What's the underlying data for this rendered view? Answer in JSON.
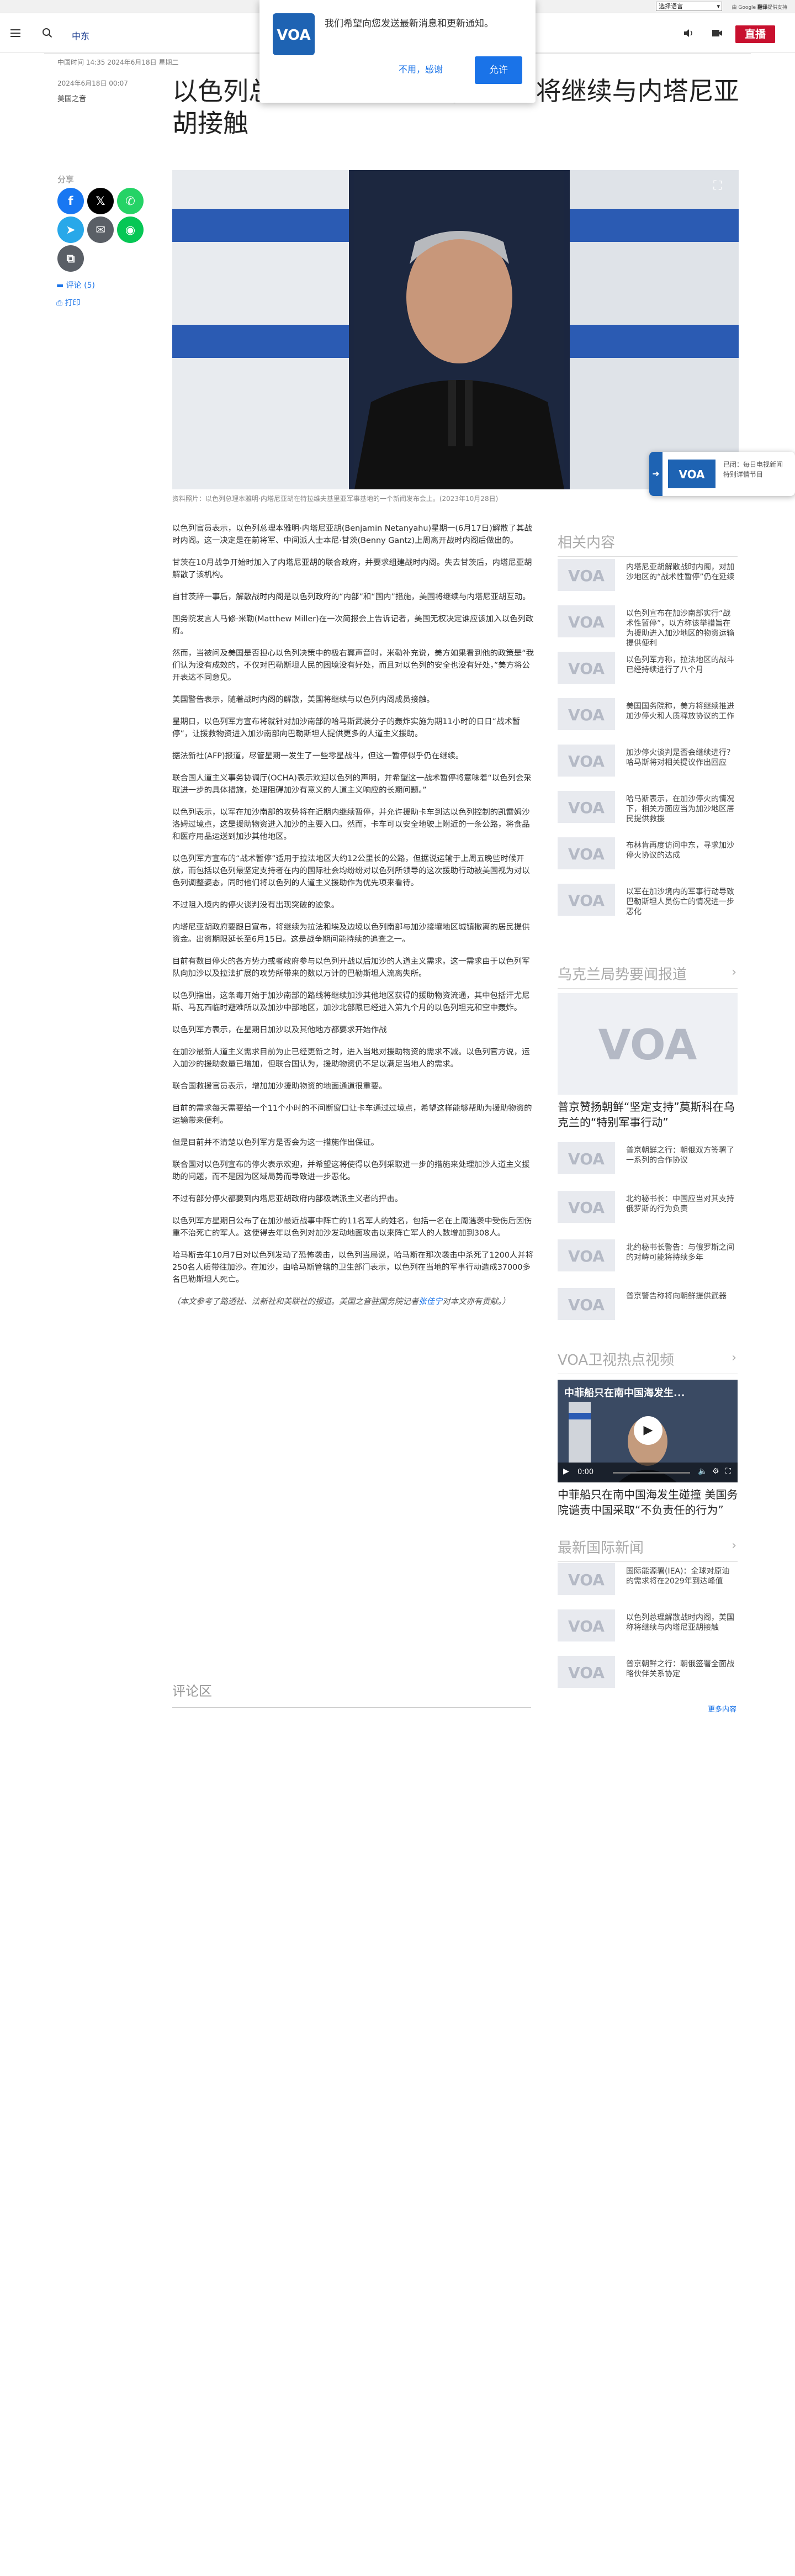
{
  "translate_bar": {
    "select_label": "选择语言",
    "powered_label": "由 Google",
    "powered_brand": "翻译",
    "powered_suffix": "提供支持"
  },
  "header": {
    "site_name": "中东",
    "live_label": "直播"
  },
  "notification": {
    "message": "我们希望向您发送最新消息和更新通知。",
    "decline_label": "不用，感谢",
    "accept_label": "允许"
  },
  "meta": {
    "updated": "中国时间 14:35 2024年6月18日 星期二",
    "date": "2024年6月18日 00:07",
    "source": "美国之音"
  },
  "title": "以色列总理解散战时内阁,美国称将继续与内塔尼亚胡接触",
  "share": {
    "label": "分享",
    "comments_label": "评论 (5)",
    "print_label": "打印"
  },
  "image_caption": "资料照片：以色列总理本雅明·内塔尼亚胡在特拉维夫基里亚军事基地的一个新闻发布会上。(2023年10月28日)",
  "floating_audio": {
    "line1": "已闭：每日电视新闻",
    "line2": "特别详情节目"
  },
  "paragraphs": [
    "以色列官员表示，以色列总理本雅明·内塔尼亚胡(Benjamin Netanyahu)星期一(6月17日)解散了其战时内阁。这一决定是在前将军、中间派人士本尼·甘茨(Benny Gantz)上周离开战时内阁后做出的。",
    "甘茨在10月战争开始时加入了内塔尼亚胡的联合政府，并要求组建战时内阁。失去甘茨后，内塔尼亚胡解散了该机构。",
    "自甘茨辞一事后，解散战时内阁是以色列政府的“内部”和“国内”措施，美国将继续与内塔尼亚胡互动。",
    "国务院发言人马修·米勒(Matthew Miller)在一次简报会上告诉记者，美国无权决定谁应该加入以色列政府。",
    "然而，当被问及美国是否担心以色列决策中的极右翼声音时，米勒补充说，美方如果看到他的政策是“我们认为没有成效的，不仅对巴勒斯坦人民的困境没有好处，而且对以色列的安全也没有好处，”美方将公开表达不同意见。",
    "美国警告表示，随着战时内阁的解散，美国将继续与以色列内阁成员接触。",
    "星期日，以色列军方宣布将就针对加沙南部的哈马斯武装分子的轰炸实施为期11小时的日日“战术暂停”，让援救物资进入加沙南部向巴勒斯坦人提供更多的人道主义援助。",
    "据法新社(AFP)报道，尽管星期一发生了一些零星战斗，但这一暂停似乎仍在继续。",
    "联合国人道主义事务协调厅(OCHA)表示欢迎以色列的声明，并希望这一战术暂停将意味着“以色列会采取进一步的具体措施，处理阻碍加沙有意义的人道主义响应的长期问题。”",
    "以色列表示，以军在加沙南部的攻势将在近期内继续暂停，并允许援助卡车到达以色列控制的凯雷姆沙洛姆过境点，这是援助物资进入加沙的主要入口。然而，卡车可以安全地驶上附近的一条公路，将食品和医疗用品运送到加沙其他地区。",
    "以色列军方宣布的“战术暂停”适用于拉法地区大约12公里长的公路，但据说运输于上周五晚些时候开放，而包括以色列最坚定支持者在内的国际社会均纷纷对以色列所领导的这次援助行动被美国视为对以色列调整姿态，同时他们将以色列的人道主义援助作为优先项来看待。",
    "不过阻入境内的停火谈判没有出现突破的迹象。",
    "内塔尼亚胡政府要跟日宣布，将继续为拉法和埃及边境以色列南部与加沙接壤地区城镇撤离的居民提供资金。出资期限延长至6月15日。这是战争期间能持续的追查之一。",
    "目前有数目停火的各方势力或者政府参与以色列开战以后加沙的人道主义需求。这一需求由于以色列军队向加沙以及拉法扩展的攻势所带来的数以万计的巴勒斯坦人流离失所。",
    "以色列指出，这条毒开始于加沙南部的路线将继续加沙其他地区获得的援助物资流通，其中包括汗尤尼斯、马瓦西临时避难所以及加沙中部地区，加沙北部限已经进入第九个月的以色列坦克和空中轰炸。",
    "以色列军方表示，在星期日加沙以及其他地方都要求开始作战",
    "在加沙最新人道主义需求目前为止已经更新之时，进入当地对援助物资的需求不减。以色列官方说，运入加沙的援助数量已增加，但联合国认为，援助物资仍不足以满足当地人的需求。",
    "联合国救援官员表示，增加加沙援助物资的地面通道很重要。",
    "目前的需求每天需要给一个11个小时的不间断窗口让卡车通过过境点，希望这样能够帮助为援助物资的运输带来便利。",
    "但是目前并不清楚以色列军方是否会为这一措施作出保证。",
    "联合国对以色列宣布的停火表示欢迎，并希望这将使得以色列采取进一步的措施来处理加沙人道主义援助的问题，而不是因为区域局势而导致进一步恶化。",
    "不过有部分停火都要到内塔尼亚胡政府内部极端派主义者的抨击。",
    "以色列军方星期日公布了在加沙最近战事中阵亡的11名军人的姓名，包括一名在上周遇袭中受伤后因伤重不治死亡的军人。这使得去年以色列对加沙发动地面攻击以来阵亡军人的人数增加到308人。",
    "哈马斯去年10月7日对以色列发动了恐怖袭击，以色列当局说，哈马斯在那次袭击中杀死了1200人并将250名人质带往加沙。在加沙，由哈马斯管辖的卫生部门表示，以色列在当地的军事行动造成37000多名巴勒斯坦人死亡。"
  ],
  "footnote": {
    "text": "（本文参考了路透社、法新社和美联社的报道。美国之音驻国务院记者张佳宁对本文亦有贡献。）",
    "author": "张佳宁"
  },
  "comments_title": "评论区",
  "related": {
    "title": "相关内容",
    "items": [
      "内塔尼亚胡解散战时内阁，对加沙地区的“战术性暂停”仍在延续",
      "以色列宣布在加沙南部实行“战术性暂停”，以方称该举措旨在为援助进入加沙地区的物资运输提供便利",
      "以色列军方称，拉法地区的战斗已经持续进行了八个月",
      "美国国务院称，美方将继续推进加沙停火和人质释放协议的工作",
      "加沙停火谈判是否会继续进行？哈马斯将对相关提议作出回应",
      "哈马斯表示，在加沙停火的情况下，相关方面应当为加沙地区居民提供救援",
      "布林肯再度访问中东，寻求加沙停火协议的达成",
      "以军在加沙境内的军事行动导致巴勒斯坦人员伤亡的情况进一步恶化"
    ]
  },
  "ukraine": {
    "title": "乌克兰局势要闻报道",
    "headline": "普京赞扬朝鲜“坚定支持”莫斯科在乌克兰的“特别军事行动”",
    "items": [
      "普京朝鲜之行：朝俄双方签署了一系列的合作协议",
      "北约秘书长：中国应当对其支持俄罗斯的行为负责",
      "北约秘书长警告：与俄罗斯之间的对峙可能将持续多年",
      "普京警告称将向朝鲜提供武器"
    ]
  },
  "video": {
    "title": "VOA卫视热点视频",
    "overlay": "中菲船只在南中国海发生...",
    "time": "0:00",
    "headline": "中菲船只在南中国海发生碰撞 美国务院谴责中国采取“不负责任的行为”"
  },
  "latest": {
    "title": "最新国际新闻",
    "items": [
      "国际能源署(IEA)：全球对原油的需求将在2029年到达峰值",
      "以色列总理解散战时内阁，美国称将继续与内塔尼亚胡接触",
      "普京朝鲜之行：朝俄签署全面战略伙伴关系协定"
    ],
    "more_label": "更多内容"
  },
  "colors": {
    "brand": "#1e63b3",
    "live": "#c8102e",
    "link": "#1a73e8"
  }
}
